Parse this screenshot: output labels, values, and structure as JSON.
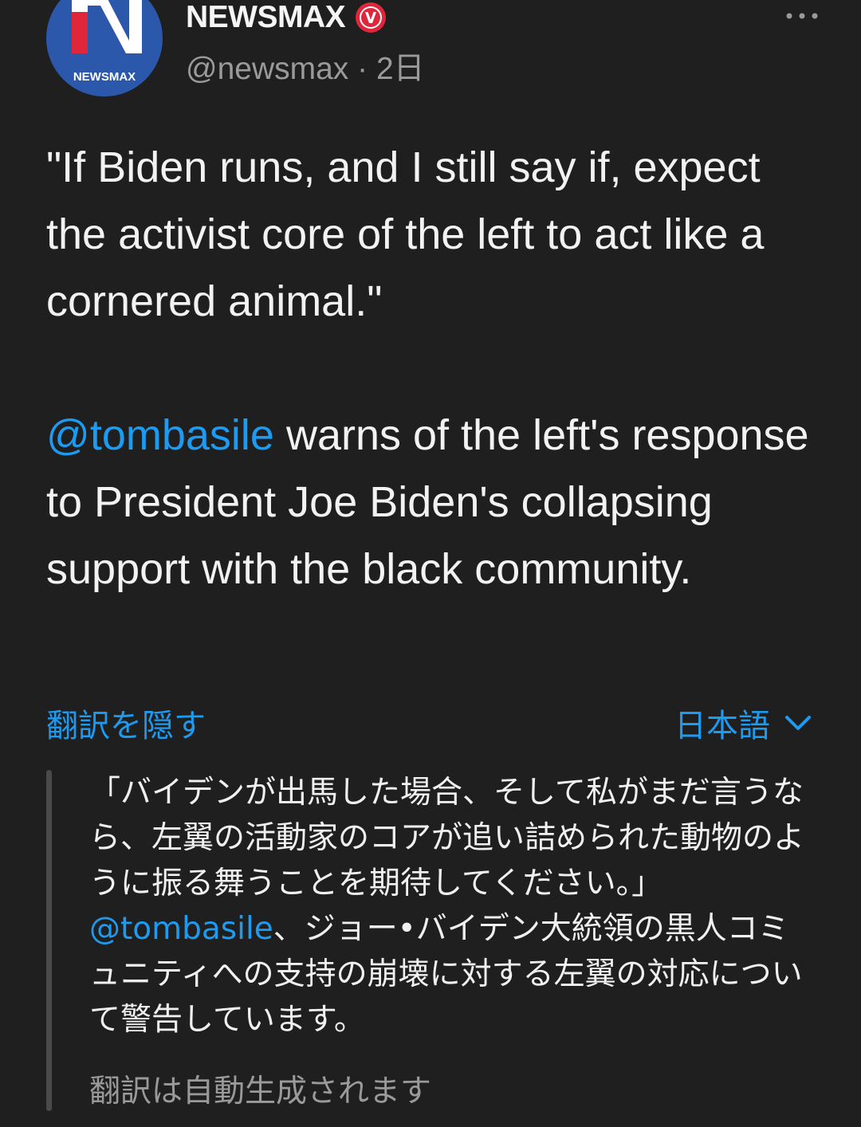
{
  "author": {
    "display_name": "NEWSMAX",
    "handle": "@newsmax",
    "separator": " · ",
    "time": "2日",
    "avatar_text": "NEWSMAX",
    "avatar_letter": "N",
    "verified_badge_text": "V"
  },
  "post": {
    "quote": "\"If Biden runs, and I still say if, expect the activist core of the left to act like a cornered animal.\"",
    "mention": "@tombasile",
    "text_after_mention": " warns of the left's response to President Joe Biden's collapsing support with the black community."
  },
  "translation": {
    "hide_label": "翻訳を隠す",
    "language": "日本語",
    "text_before_mention": "「バイデンが出馬した場合、そして私がまだ言うなら、左翼の活動家のコアが追い詰められた動物のように振る舞うことを期待してください。」 ",
    "mention": "@tombasile",
    "text_after_mention": "、ジョー•バイデン大統領の黒人コミュニティへの支持の崩壊に対する左翼の対応について警告しています。",
    "note": "翻訳は自動生成されます"
  },
  "colors": {
    "background": "#1f1f1f",
    "link": "#1d9bf0",
    "verified_badge": "#e0263b",
    "avatar_blue": "#2a56a8",
    "muted_text": "#9a9a9a"
  },
  "icons": {
    "more": "more-horizontal-icon",
    "verified": "verified-badge-icon",
    "language_dropdown": "chevron-down-icon"
  }
}
